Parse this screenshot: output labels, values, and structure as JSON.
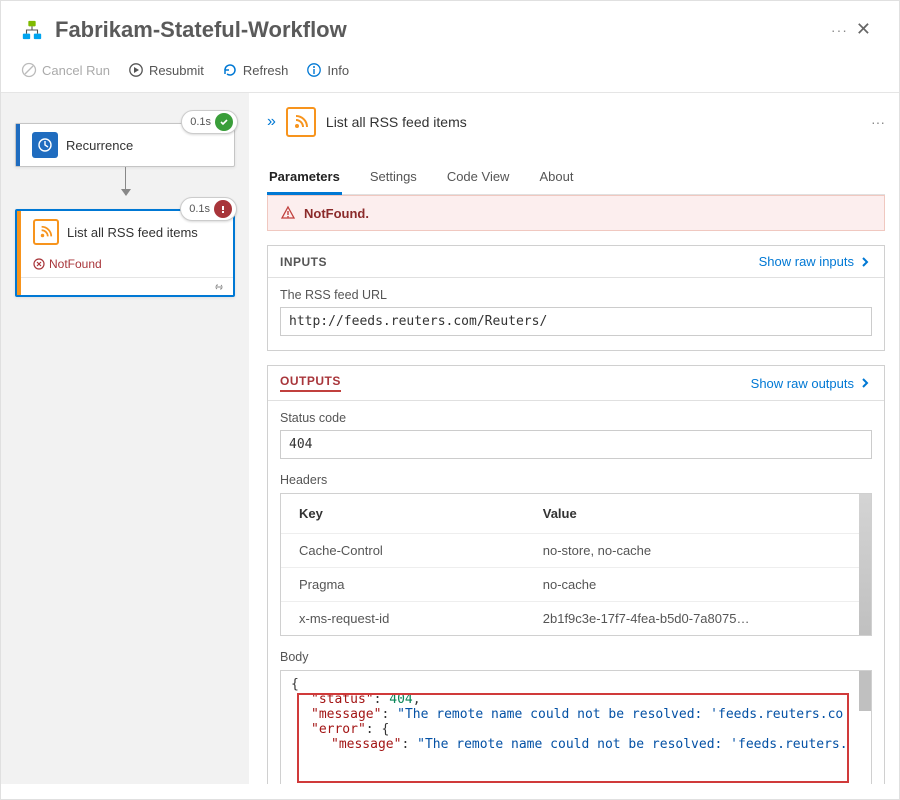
{
  "header": {
    "title": "Fabrikam-Stateful-Workflow"
  },
  "toolbar": {
    "cancel": "Cancel Run",
    "resubmit": "Resubmit",
    "refresh": "Refresh",
    "info": "Info"
  },
  "workflow": {
    "node1": {
      "label": "Recurrence",
      "badge_time": "0.1s"
    },
    "node2": {
      "label": "List all RSS feed items",
      "badge_time": "0.1s",
      "status": "NotFound"
    }
  },
  "panel": {
    "title": "List all RSS feed items",
    "tabs": {
      "parameters": "Parameters",
      "settings": "Settings",
      "codeview": "Code View",
      "about": "About"
    },
    "alert_text": "NotFound.",
    "inputs": {
      "title": "INPUTS",
      "show_raw": "Show raw inputs",
      "field_label": "The RSS feed URL",
      "field_value": "http://feeds.reuters.com/Reuters/"
    },
    "outputs": {
      "title": "OUTPUTS",
      "show_raw": "Show raw outputs",
      "status_label": "Status code",
      "status_value": "404",
      "headers_label": "Headers",
      "headers_cols": {
        "key": "Key",
        "value": "Value"
      },
      "headers": [
        {
          "k": "Cache-Control",
          "v": "no-store, no-cache"
        },
        {
          "k": "Pragma",
          "v": "no-cache"
        },
        {
          "k": "x-ms-request-id",
          "v": "2b1f9c3e-17f7-4fea-b5d0-7a8075…"
        }
      ],
      "body_label": "Body",
      "body": {
        "status": 404,
        "msg": "The remote name could not be resolved: 'feeds.reuters.co",
        "msg2": "The remote name could not be resolved: 'feeds.reuters."
      }
    }
  }
}
